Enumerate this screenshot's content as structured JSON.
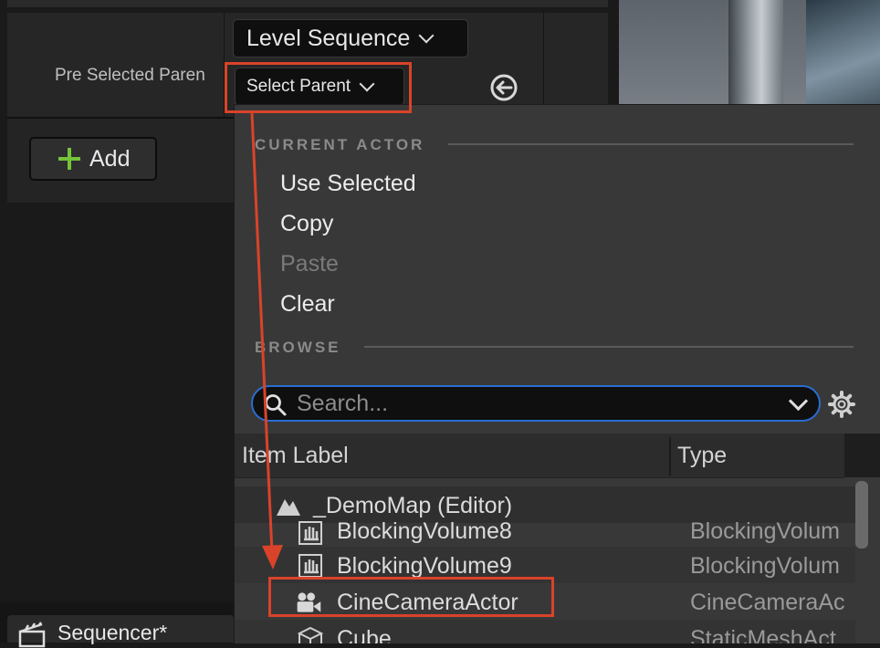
{
  "details": {
    "property_label": "Pre Selected Paren",
    "level_sequence_combo": "Level Sequence",
    "select_parent_combo": "Select Parent",
    "add_button": "Add"
  },
  "bottom_tab": {
    "label": "Sequencer*"
  },
  "menu": {
    "current_actor_header": "CURRENT ACTOR",
    "items": [
      {
        "label": "Use Selected",
        "enabled": true
      },
      {
        "label": "Copy",
        "enabled": true
      },
      {
        "label": "Paste",
        "enabled": false
      },
      {
        "label": "Clear",
        "enabled": true
      }
    ],
    "browse_header": "BROWSE",
    "search": {
      "placeholder": "Search..."
    },
    "columns": {
      "item_label": "Item Label",
      "type": "Type"
    },
    "tree": [
      {
        "label": "_DemoMap (Editor)",
        "type": "",
        "icon": "level-map-icon"
      },
      {
        "label": "BlockingVolume8",
        "type": "BlockingVolum",
        "icon": "blocking-volume-icon"
      },
      {
        "label": "BlockingVolume9",
        "type": "BlockingVolum",
        "icon": "blocking-volume-icon"
      },
      {
        "label": "CineCameraActor",
        "type": "CineCameraAc",
        "icon": "cine-camera-icon"
      },
      {
        "label": "Cube",
        "type": "StaticMeshAct",
        "icon": "static-mesh-icon"
      }
    ]
  },
  "annotation_color": "#d9432a",
  "accent_color": "#2a6dd1"
}
